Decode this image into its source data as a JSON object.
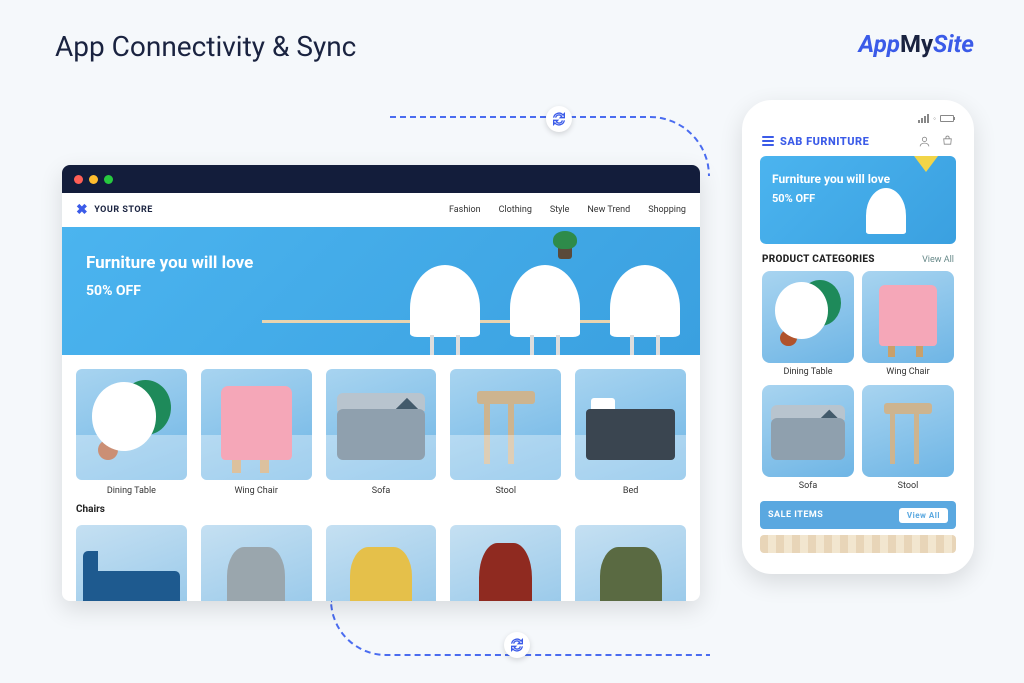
{
  "page_title": "App Connectivity & Sync",
  "brand": {
    "app": "App",
    "my": "My",
    "site": "Site"
  },
  "browser": {
    "store_name": "YOUR STORE",
    "nav": [
      "Fashion",
      "Clothing",
      "Style",
      "New Trend",
      "Shopping"
    ],
    "hero": {
      "headline": "Furniture you will love",
      "discount": "50% OFF"
    },
    "products": [
      {
        "label": "Dining Table"
      },
      {
        "label": "Wing Chair"
      },
      {
        "label": "Sofa"
      },
      {
        "label": "Stool"
      },
      {
        "label": "Bed"
      }
    ],
    "section_chairs": "Chairs"
  },
  "phone": {
    "brand": "SAB FURNITURE",
    "hero": {
      "headline": "Furniture you will love",
      "discount": "50% OFF"
    },
    "categories_title": "PRODUCT CATEGORIES",
    "view_all": "View All",
    "categories": [
      {
        "label": "Dining Table"
      },
      {
        "label": "Wing Chair"
      },
      {
        "label": "Sofa"
      },
      {
        "label": "Stool"
      }
    ],
    "sale_title": "SALE ITEMS",
    "sale_view_all": "View All"
  }
}
